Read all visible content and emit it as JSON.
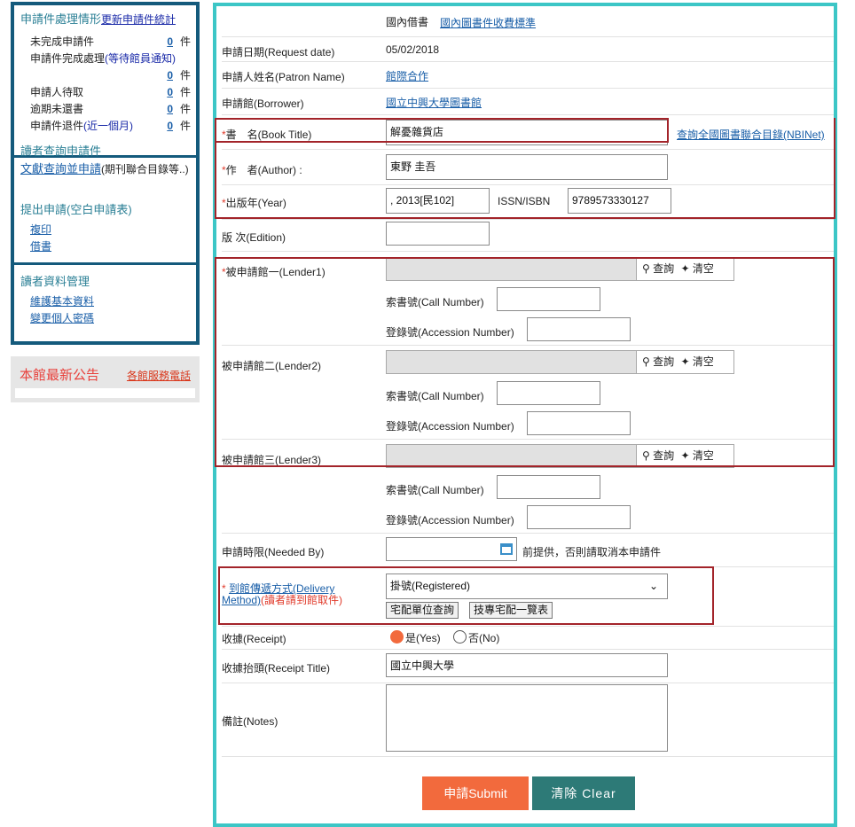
{
  "sidebar": {
    "status_title": "申請件處理情形",
    "status_update_link": "更新申請件統計",
    "stats": [
      {
        "label": "未完成申請件",
        "count": "0",
        "unit": "件"
      },
      {
        "label_prefix": "申請件完成處理",
        "label_link": "(等待館員通知)",
        "count": "0",
        "unit": "件"
      },
      {
        "label": "申請人待取",
        "count": "0",
        "unit": "件"
      },
      {
        "label": "逾期未還書",
        "count": "0",
        "unit": "件"
      },
      {
        "label_prefix": "申請件退件",
        "label_link": "(近一個月)",
        "count": "0",
        "unit": "件"
      }
    ],
    "query_requests": "讀者查詢申請件",
    "search_apply_link": "文獻查詢並申請",
    "search_apply_note": "(期刊聯合目錄等..)",
    "blank_form_title": "提出申請(空白申請表)",
    "blank_form_links": [
      "複印",
      "借書"
    ],
    "reader_data_title": "讀者資料管理",
    "reader_data_links": [
      "維護基本資料",
      "變更個人密碼"
    ],
    "news_title": "本館最新公告",
    "news_link": "各館服務電話"
  },
  "form": {
    "service_type": "國內借書",
    "fee_link": "國內圖書件收費標準",
    "request_date_label": "申請日期(Request date)",
    "request_date_value": "05/02/2018",
    "patron_label": "申請人姓名(Patron Name)",
    "patron_value": "館際合作",
    "borrower_label": "申請館(Borrower)",
    "borrower_value": "國立中興大學圖書館",
    "title_label": "書　名(Book Title)",
    "title_value": "解憂雜貨店",
    "nbinet_link": "查詢全國圖書聯合目錄(NBINet)",
    "author_label": "作　者(Author) :",
    "author_value": "東野 圭吾",
    "year_label": "出版年(Year)",
    "year_value": ", 2013[民102]",
    "issn_label": "ISSN/ISBN",
    "issn_value": "9789573330127",
    "edition_label": "版 次(Edition)",
    "edition_value": "",
    "lenders": [
      {
        "label": "被申請館一(Lender1)"
      },
      {
        "label": "被申請館二(Lender2)"
      },
      {
        "label": "被申請館三(Lender3)"
      }
    ],
    "query_btn": "查詢",
    "clear_btn": "清空",
    "call_number_label": "索書號(Call Number)",
    "accession_label": "登錄號(Accession Number)",
    "needed_by_label": "申請時限(Needed By)",
    "needed_by_note": "前提供，否則請取消本申請件",
    "delivery_label_link": "到館傳遞方式(Delivery Method)",
    "delivery_note": "(讀者請到館取件)",
    "delivery_value": "掛號(Registered)",
    "delivery_btn1": "宅配單位查詢",
    "delivery_btn2": "技專宅配一覽表",
    "receipt_label": "收據(Receipt)",
    "receipt_yes": "是(Yes)",
    "receipt_no": "否(No)",
    "receipt_title_label": "收據抬頭(Receipt Title)",
    "receipt_title_value": "國立中興大學",
    "notes_label": "備註(Notes)",
    "submit": "申請Submit",
    "clear": "清除 Clear"
  },
  "colors": {
    "sidebar_border": "#145a7c",
    "main_border": "#3cc6c6",
    "highlight_box": "#a3242a",
    "submit_bg": "#f26a3d",
    "clear_bg": "#2d7a77",
    "radio_selected": "#f26a3d"
  }
}
